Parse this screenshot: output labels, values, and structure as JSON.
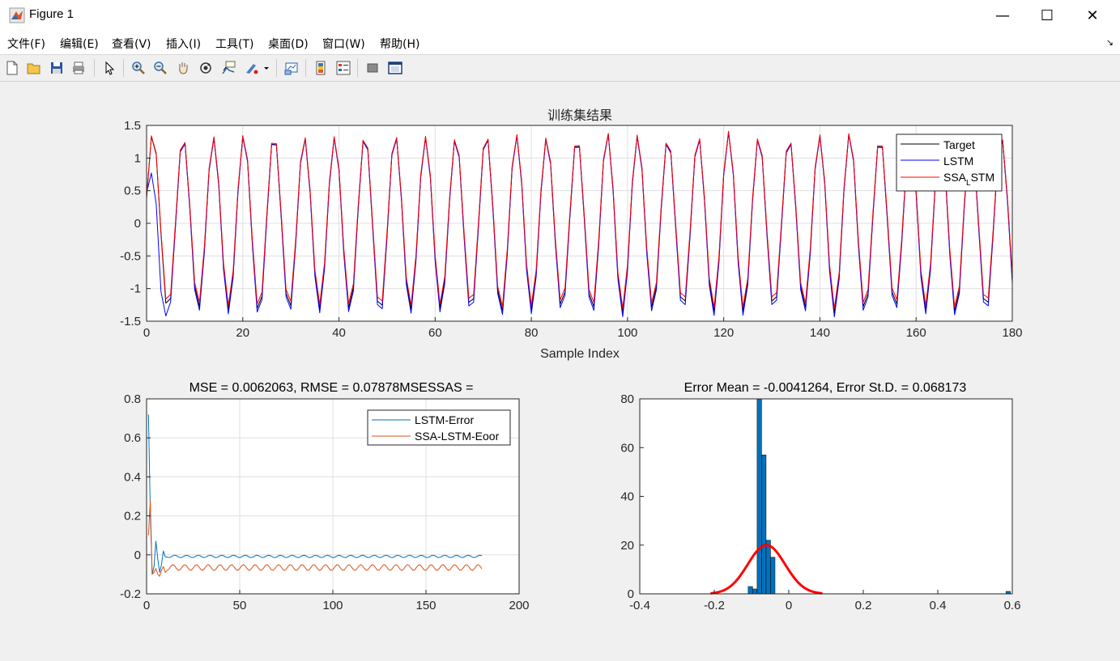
{
  "window": {
    "title": "Figure 1",
    "minimize": "—",
    "maximize": "☐",
    "close": "✕"
  },
  "menu": [
    "文件(F)",
    "编辑(E)",
    "查看(V)",
    "插入(I)",
    "工具(T)",
    "桌面(D)",
    "窗口(W)",
    "帮助(H)"
  ],
  "toolbar_icons": [
    "new-figure-icon",
    "open-file-icon",
    "save-icon",
    "print-icon",
    "pointer-icon",
    "zoom-in-icon",
    "zoom-out-icon",
    "pan-icon",
    "rotate-3d-icon",
    "data-cursor-icon",
    "brush-icon",
    "link-plot-icon",
    "colorbar-icon",
    "legend-icon",
    "hide-plot-tools-icon",
    "show-plot-tools-icon"
  ],
  "colors": {
    "target": "#000000",
    "lstm": "#0000ff",
    "ssa_lstm": "#ff0000",
    "err1": "#0072bd",
    "err2": "#d95319",
    "hist": "#0072bd",
    "fit": "#ff0000"
  },
  "chart_data": [
    {
      "type": "line",
      "title": "训练集结果",
      "xlabel": "Sample Index",
      "ylabel": "",
      "xlim": [
        0,
        180
      ],
      "ylim": [
        -1.5,
        1.5
      ],
      "xticks": [
        "0",
        "20",
        "40",
        "60",
        "80",
        "100",
        "120",
        "140",
        "160",
        "180"
      ],
      "yticks": [
        "1.5",
        "1",
        "0.5",
        "0",
        "-0.5",
        "-1",
        "-1.5"
      ],
      "grid": true,
      "legend_position": "top-right",
      "series": [
        {
          "name": "Target",
          "color": "#000000",
          "description": "periodic oscillation, period ~6.3 samples, amplitude ~1.4"
        },
        {
          "name": "LSTM",
          "color": "#0000ff",
          "start_values": [
            0.47,
            0.77,
            0.3,
            -1.05,
            -1.42
          ]
        },
        {
          "name": "SSA",
          "name_subscript": "L",
          "name_suffix": "STM",
          "color": "#ff0000"
        }
      ],
      "signal": {
        "amplitude": 1.4,
        "period": 6.3,
        "phase_peak": 1.3,
        "envelope": 0.06
      }
    },
    {
      "type": "line",
      "title": "MSE = 0.0062063, RMSE = 0.07878MSESSAS =",
      "xlim": [
        0,
        200
      ],
      "ylim": [
        -0.2,
        0.8
      ],
      "xticks": [
        "0",
        "50",
        "100",
        "150",
        "200"
      ],
      "yticks": [
        "0.8",
        "0.6",
        "0.4",
        "0.2",
        "0",
        "-0.2"
      ],
      "grid": true,
      "legend_position": "top-right",
      "series": [
        {
          "name": "LSTM-Error",
          "color": "#0072bd",
          "start_values": [
            0.72,
            0.22,
            -0.1,
            -0.06,
            0.07,
            -0.02,
            -0.09,
            -0.05,
            0.02,
            -0.01
          ],
          "steady_mean": -0.008,
          "steady_amp": 0.006
        },
        {
          "name": "SSA-LSTM-Eoor",
          "color": "#d95319",
          "start_values": [
            0.1,
            0.28,
            -0.1,
            -0.09,
            -0.07,
            -0.1,
            -0.11,
            -0.08,
            -0.06,
            -0.09
          ],
          "steady_mean": -0.065,
          "steady_amp": 0.015
        }
      ],
      "n_points": 180
    },
    {
      "type": "histogram",
      "title": "Error Mean = -0.0041264, Error St.D. = 0.068173",
      "xlim": [
        -0.4,
        0.6
      ],
      "ylim": [
        0,
        80
      ],
      "xticks": [
        "-0.4",
        "-0.2",
        "0",
        "0.2",
        "0.4",
        "0.6"
      ],
      "yticks": [
        "80",
        "60",
        "40",
        "20",
        "0"
      ],
      "bins": [
        {
          "x0": -0.109,
          "x1": -0.097,
          "count": 3
        },
        {
          "x0": -0.097,
          "x1": -0.085,
          "count": 2
        },
        {
          "x0": -0.085,
          "x1": -0.073,
          "count": 80
        },
        {
          "x0": -0.073,
          "x1": -0.061,
          "count": 57
        },
        {
          "x0": -0.061,
          "x1": -0.049,
          "count": 22
        },
        {
          "x0": -0.049,
          "x1": -0.037,
          "count": 15
        },
        {
          "x0": 0.583,
          "x1": 0.595,
          "count": 1
        }
      ],
      "fit_curve": {
        "mean": -0.06,
        "sigma": 0.05,
        "peak": 20,
        "x_range": [
          -0.21,
          0.09
        ],
        "color": "#ff0000"
      }
    }
  ]
}
